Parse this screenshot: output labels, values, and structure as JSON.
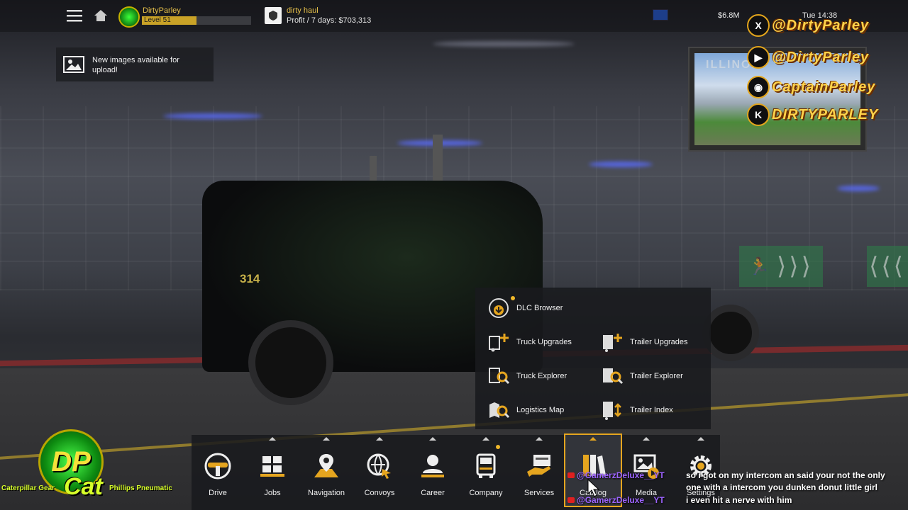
{
  "topbar": {
    "menu_icon": "hamburger-icon",
    "home_icon": "home-icon",
    "user": {
      "name": "DirtyParley",
      "level_label": "Level 51",
      "level_progress": 0.5
    },
    "company": {
      "name": "dirty haul",
      "profit": "Profit / 7 days: $703,313"
    },
    "money": "$6.8M",
    "clock": "Tue 14:38"
  },
  "notification": {
    "icon": "image-icon",
    "text": "New images available for upload!"
  },
  "overlay": {
    "image_title": "ILLINOIS",
    "social": [
      {
        "icon": "x-icon",
        "glyph": "X",
        "handle": "@DirtyParley"
      },
      {
        "icon": "youtube-icon",
        "glyph": "▶",
        "handle": "@DirtyParley"
      },
      {
        "icon": "discord-icon",
        "glyph": "◉",
        "handle": "CaptainParley"
      },
      {
        "icon": "kick-icon",
        "glyph": "K",
        "handle": "DIRTYPARLEY"
      }
    ]
  },
  "exit_signs": {
    "left": "⟩⟩⟩",
    "right": "⟨⟨⟨"
  },
  "truck_number": "314",
  "catalog_menu": {
    "dlc_browser": "DLC Browser",
    "truck_upgrades": "Truck Upgrades",
    "trailer_upgrades": "Trailer Upgrades",
    "truck_explorer": "Truck Explorer",
    "trailer_explorer": "Trailer Explorer",
    "logistics_map": "Logistics Map",
    "trailer_index": "Trailer Index"
  },
  "bottom_nav": {
    "drive": "Drive",
    "jobs": "Jobs",
    "navigation": "Navigation",
    "convoys": "Convoys",
    "career": "Career",
    "company": "Company",
    "services": "Services",
    "catalog": "Catalog",
    "media": "Media",
    "settings": "Settings"
  },
  "branding": {
    "logo_text": "DP",
    "banner": "Cat",
    "left_text": "Caterpillar Gear",
    "right_text": "Phillips Pneumatic"
  },
  "chat": [
    {
      "user": "@GamerzDeluxe__YT",
      "message": "so i got on my intercom an said your not the only"
    },
    {
      "user": "",
      "message": "one with a intercom you dunken donut little girl"
    },
    {
      "user": "@GamerzDeluxe__YT",
      "message": "i even hit a nerve with him"
    }
  ],
  "colors": {
    "accent": "#e5a51f",
    "username": "#e8c24a",
    "chat_name": "#9d64ff"
  }
}
